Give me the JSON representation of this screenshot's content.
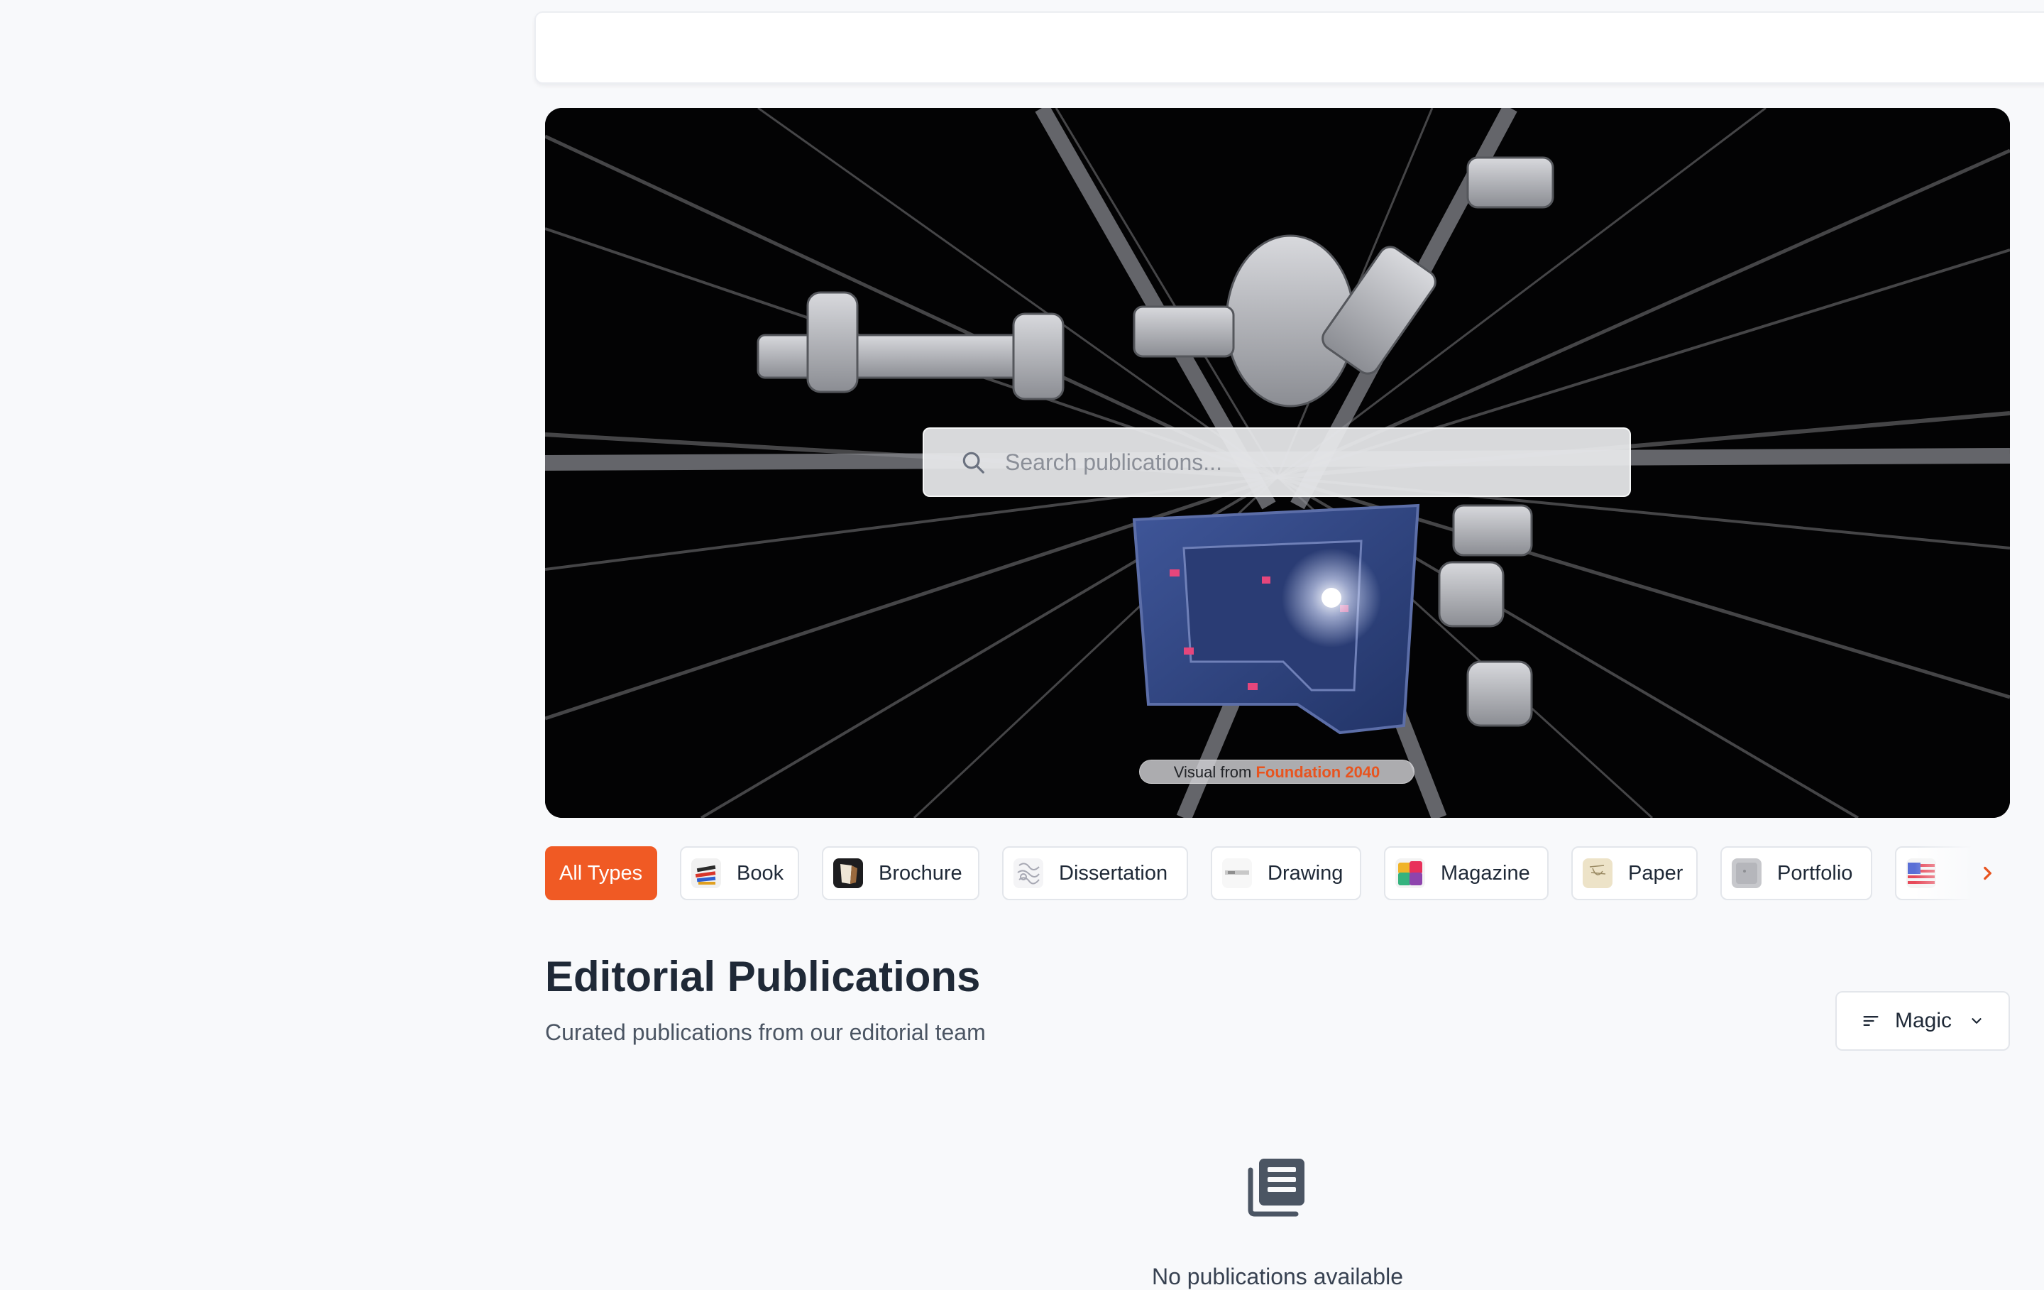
{
  "hero": {
    "search_placeholder": "Search publications...",
    "credit_prefix": "Visual from",
    "credit_link": "Foundation 2040"
  },
  "type_filters": {
    "items": [
      {
        "label": "All Types",
        "active": true
      },
      {
        "label": "Book",
        "thumb": "book-thumbnail"
      },
      {
        "label": "Brochure",
        "thumb": "brochure-thumbnail"
      },
      {
        "label": "Dissertation",
        "thumb": "dissertation-thumbnail"
      },
      {
        "label": "Drawing",
        "thumb": "drawing-thumbnail"
      },
      {
        "label": "Magazine",
        "thumb": "magazine-thumbnail"
      },
      {
        "label": "Paper",
        "thumb": "paper-thumbnail"
      },
      {
        "label": "Portfolio",
        "thumb": "portfolio-thumbnail"
      },
      {
        "label": "",
        "thumb": "flag-thumbnail"
      }
    ],
    "next_icon": "chevron-right-icon"
  },
  "section": {
    "title": "Editorial Publications",
    "subtitle": "Curated publications from our editorial team",
    "sort_label": "Magic",
    "sort_icon": "sort-lines-icon"
  },
  "empty_state": {
    "icon": "newspaper-stack-icon",
    "message": "No publications available"
  },
  "colors": {
    "accent": "#f05a24",
    "page_background": "#f8f9fb",
    "text_primary": "#1f2937",
    "text_secondary": "#4b5563"
  }
}
